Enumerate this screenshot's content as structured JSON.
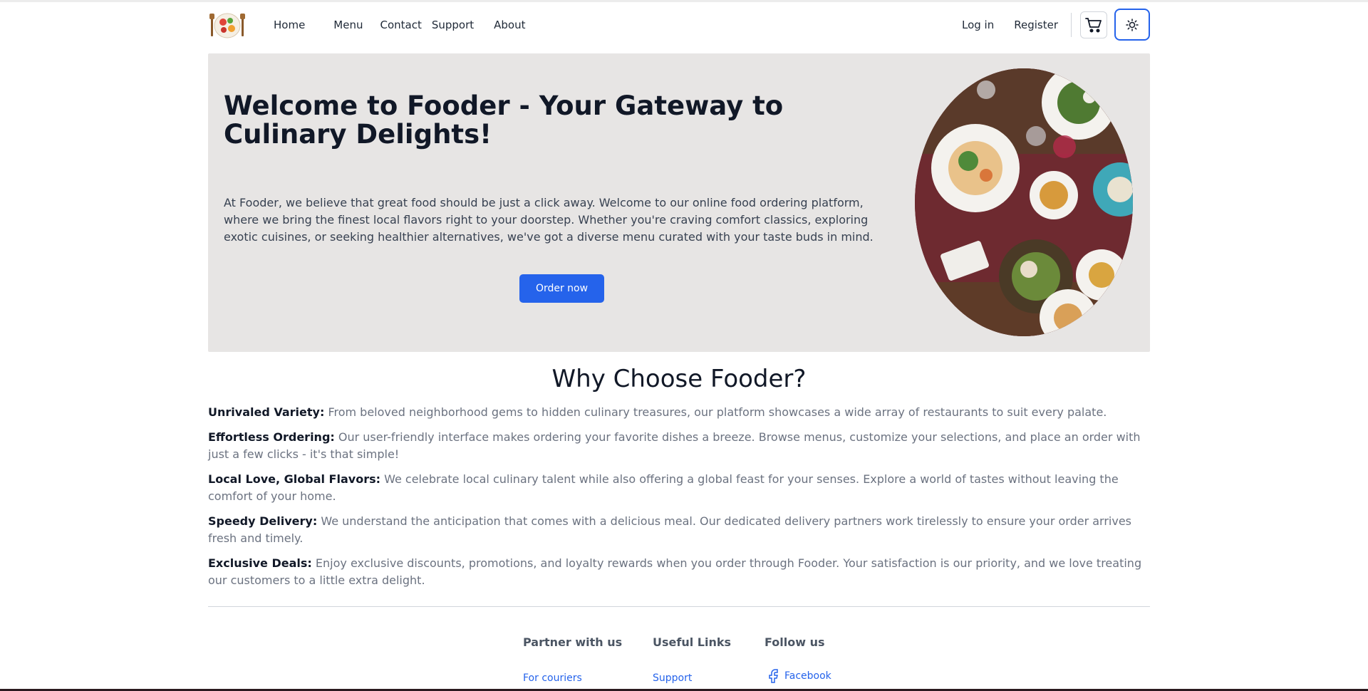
{
  "nav": {
    "logo_icon": "food-plate-logo-icon",
    "links": [
      "Home",
      "Menu",
      "Contact",
      "Support",
      "About"
    ],
    "login": "Log in",
    "register": "Register",
    "cart_icon": "cart-icon",
    "theme_icon": "sun-icon"
  },
  "hero": {
    "title": "Welcome to Fooder - Your Gateway to Culinary Delights!",
    "text": "At Fooder, we believe that great food should be just a click away. Welcome to our online food ordering platform, where we bring the finest local flavors right to your doorstep. Whether you're craving comfort classics, exploring exotic cuisines, or seeking healthier alternatives, we've got a diverse menu curated with your taste buds in mind.",
    "button": "Order now"
  },
  "why": {
    "title": "Why Choose Fooder?",
    "features": [
      {
        "label": "Unrivaled Variety:",
        "text": " From beloved neighborhood gems to hidden culinary treasures, our platform showcases a wide array of restaurants to suit every palate."
      },
      {
        "label": "Effortless Ordering:",
        "text": " Our user-friendly interface makes ordering your favorite dishes a breeze. Browse menus, customize your selections, and place an order with just a few clicks - it's that simple!"
      },
      {
        "label": "Local Love, Global Flavors:",
        "text": " We celebrate local culinary talent while also offering a global feast for your senses. Explore a world of tastes without leaving the comfort of your home."
      },
      {
        "label": "Speedy Delivery:",
        "text": " We understand the anticipation that comes with a delicious meal. Our dedicated delivery partners work tirelessly to ensure your order arrives fresh and timely."
      },
      {
        "label": "Exclusive Deals:",
        "text": " Enjoy exclusive discounts, promotions, and loyalty rewards when you order through Fooder. Your satisfaction is our priority, and we love treating our customers to a little extra delight."
      }
    ]
  },
  "footer": {
    "partner": {
      "heading": "Partner with us",
      "link": "For couriers"
    },
    "useful": {
      "heading": "Useful Links",
      "link": "Support"
    },
    "follow": {
      "heading": "Follow us",
      "link": "Facebook",
      "icon": "facebook-icon"
    }
  },
  "colors": {
    "accent": "#2563eb",
    "hero_bg": "#e7e5e4"
  }
}
